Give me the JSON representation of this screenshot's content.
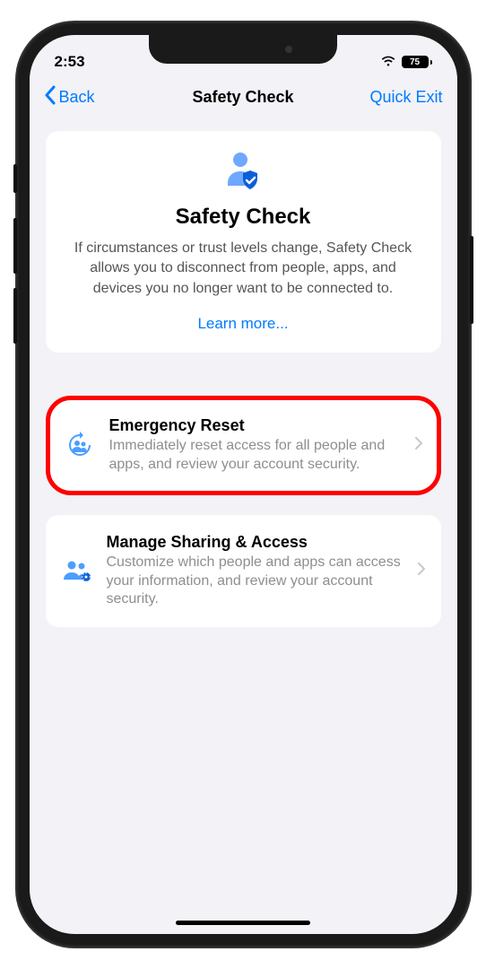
{
  "status": {
    "time": "2:53",
    "battery": "75"
  },
  "nav": {
    "back": "Back",
    "title": "Safety Check",
    "right": "Quick Exit"
  },
  "hero": {
    "title": "Safety Check",
    "description": "If circumstances or trust levels change, Safety Check allows you to disconnect from people, apps, and devices you no longer want to be connected to.",
    "learnMore": "Learn more..."
  },
  "options": {
    "emergency": {
      "title": "Emergency Reset",
      "description": "Immediately reset access for all people and apps, and review your account security."
    },
    "manage": {
      "title": "Manage Sharing & Access",
      "description": "Customize which people and apps can access your information, and review your account security."
    }
  }
}
